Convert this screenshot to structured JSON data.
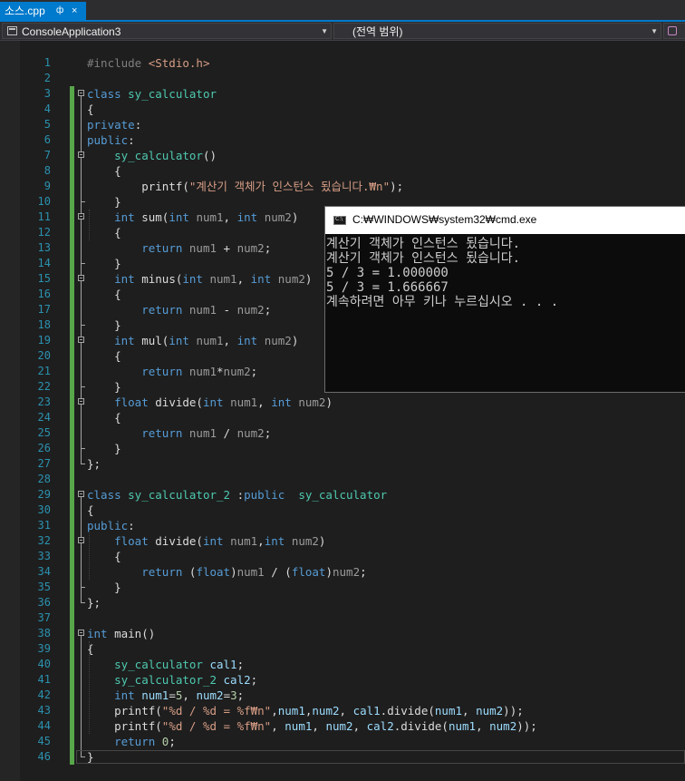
{
  "tab": {
    "title": "소스.cpp",
    "pin": "ф",
    "close": "×"
  },
  "nav": {
    "project": "ConsoleApplication3",
    "scope": "(전역 범위)"
  },
  "lines": [
    [
      [
        "p",
        "#include "
      ],
      [
        "s",
        "<Stdio.h>"
      ]
    ],
    [],
    [
      [
        "k",
        "class "
      ],
      [
        "t",
        "sy_calculator"
      ]
    ],
    [
      [
        "f",
        "{"
      ]
    ],
    [
      [
        "k",
        "private"
      ],
      [
        "f",
        ":"
      ]
    ],
    [
      [
        "k",
        "public"
      ],
      [
        "f",
        ":"
      ]
    ],
    [
      [
        "f",
        "    "
      ],
      [
        "t",
        "sy_calculator"
      ],
      [
        "f",
        "()"
      ]
    ],
    [
      [
        "f",
        "    {"
      ]
    ],
    [
      [
        "f",
        "        printf("
      ],
      [
        "s",
        "\"계산기 객체가 인스턴스 됬습니다.₩n\""
      ],
      [
        "f",
        ");"
      ]
    ],
    [
      [
        "f",
        "    }"
      ]
    ],
    [
      [
        "f",
        "    "
      ],
      [
        "k",
        "int "
      ],
      [
        "f",
        "sum("
      ],
      [
        "k",
        "int "
      ],
      [
        "m",
        "num1"
      ],
      [
        "f",
        ", "
      ],
      [
        "k",
        "int "
      ],
      [
        "m",
        "num2"
      ],
      [
        "f",
        ")"
      ]
    ],
    [
      [
        "f",
        "    {"
      ]
    ],
    [
      [
        "f",
        "        "
      ],
      [
        "k",
        "return "
      ],
      [
        "m",
        "num1"
      ],
      [
        "f",
        " + "
      ],
      [
        "m",
        "num2"
      ],
      [
        "f",
        ";"
      ]
    ],
    [
      [
        "f",
        "    }"
      ]
    ],
    [
      [
        "f",
        "    "
      ],
      [
        "k",
        "int "
      ],
      [
        "f",
        "minus("
      ],
      [
        "k",
        "int "
      ],
      [
        "m",
        "num1"
      ],
      [
        "f",
        ", "
      ],
      [
        "k",
        "int "
      ],
      [
        "m",
        "num2"
      ],
      [
        "f",
        ")"
      ]
    ],
    [
      [
        "f",
        "    {"
      ]
    ],
    [
      [
        "f",
        "        "
      ],
      [
        "k",
        "return "
      ],
      [
        "m",
        "num1"
      ],
      [
        "f",
        " - "
      ],
      [
        "m",
        "num2"
      ],
      [
        "f",
        ";"
      ]
    ],
    [
      [
        "f",
        "    }"
      ]
    ],
    [
      [
        "f",
        "    "
      ],
      [
        "k",
        "int "
      ],
      [
        "f",
        "mul("
      ],
      [
        "k",
        "int "
      ],
      [
        "m",
        "num1"
      ],
      [
        "f",
        ", "
      ],
      [
        "k",
        "int "
      ],
      [
        "m",
        "num2"
      ],
      [
        "f",
        ")"
      ]
    ],
    [
      [
        "f",
        "    {"
      ]
    ],
    [
      [
        "f",
        "        "
      ],
      [
        "k",
        "return "
      ],
      [
        "m",
        "num1"
      ],
      [
        "f",
        "*"
      ],
      [
        "m",
        "num2"
      ],
      [
        "f",
        ";"
      ]
    ],
    [
      [
        "f",
        "    }"
      ]
    ],
    [
      [
        "f",
        "    "
      ],
      [
        "k",
        "float "
      ],
      [
        "f",
        "divide("
      ],
      [
        "k",
        "int "
      ],
      [
        "m",
        "num1"
      ],
      [
        "f",
        ", "
      ],
      [
        "k",
        "int "
      ],
      [
        "m",
        "num2"
      ],
      [
        "f",
        ")"
      ]
    ],
    [
      [
        "f",
        "    {"
      ]
    ],
    [
      [
        "f",
        "        "
      ],
      [
        "k",
        "return "
      ],
      [
        "m",
        "num1"
      ],
      [
        "f",
        " / "
      ],
      [
        "m",
        "num2"
      ],
      [
        "f",
        ";"
      ]
    ],
    [
      [
        "f",
        "    }"
      ]
    ],
    [
      [
        "f",
        "};"
      ]
    ],
    [],
    [
      [
        "k",
        "class "
      ],
      [
        "t",
        "sy_calculator_2 "
      ],
      [
        "f",
        ":"
      ],
      [
        "k",
        "public  "
      ],
      [
        "t",
        "sy_calculator"
      ]
    ],
    [
      [
        "f",
        "{"
      ]
    ],
    [
      [
        "k",
        "public"
      ],
      [
        "f",
        ":"
      ]
    ],
    [
      [
        "f",
        "    "
      ],
      [
        "k",
        "float "
      ],
      [
        "f",
        "divide("
      ],
      [
        "k",
        "int "
      ],
      [
        "m",
        "num1"
      ],
      [
        "f",
        ","
      ],
      [
        "k",
        "int "
      ],
      [
        "m",
        "num2"
      ],
      [
        "f",
        ")"
      ]
    ],
    [
      [
        "f",
        "    {"
      ]
    ],
    [
      [
        "f",
        "        "
      ],
      [
        "k",
        "return "
      ],
      [
        "f",
        "("
      ],
      [
        "k",
        "float"
      ],
      [
        "f",
        ")"
      ],
      [
        "m",
        "num1"
      ],
      [
        "f",
        " / ("
      ],
      [
        "k",
        "float"
      ],
      [
        "f",
        ")"
      ],
      [
        "m",
        "num2"
      ],
      [
        "f",
        ";"
      ]
    ],
    [
      [
        "f",
        "    }"
      ]
    ],
    [
      [
        "f",
        "};"
      ]
    ],
    [],
    [
      [
        "k",
        "int "
      ],
      [
        "f",
        "main()"
      ]
    ],
    [
      [
        "f",
        "{"
      ]
    ],
    [
      [
        "f",
        "    "
      ],
      [
        "t",
        "sy_calculator "
      ],
      [
        "v",
        "cal1"
      ],
      [
        "f",
        ";"
      ]
    ],
    [
      [
        "f",
        "    "
      ],
      [
        "t",
        "sy_calculator_2 "
      ],
      [
        "v",
        "cal2"
      ],
      [
        "f",
        ";"
      ]
    ],
    [
      [
        "f",
        "    "
      ],
      [
        "k",
        "int "
      ],
      [
        "v",
        "num1"
      ],
      [
        "f",
        "="
      ],
      [
        "n",
        "5"
      ],
      [
        "f",
        ", "
      ],
      [
        "v",
        "num2"
      ],
      [
        "f",
        "="
      ],
      [
        "n",
        "3"
      ],
      [
        "f",
        ";"
      ]
    ],
    [
      [
        "f",
        "    printf("
      ],
      [
        "s",
        "\"%d / %d = %f₩n\""
      ],
      [
        "f",
        ","
      ],
      [
        "v",
        "num1"
      ],
      [
        "f",
        ","
      ],
      [
        "v",
        "num2"
      ],
      [
        "f",
        ", "
      ],
      [
        "v",
        "cal1"
      ],
      [
        "f",
        ".divide("
      ],
      [
        "v",
        "num1"
      ],
      [
        "f",
        ", "
      ],
      [
        "v",
        "num2"
      ],
      [
        "f",
        "));"
      ]
    ],
    [
      [
        "f",
        "    printf("
      ],
      [
        "s",
        "\"%d / %d = %f₩n\""
      ],
      [
        "f",
        ", "
      ],
      [
        "v",
        "num1"
      ],
      [
        "f",
        ", "
      ],
      [
        "v",
        "num2"
      ],
      [
        "f",
        ", "
      ],
      [
        "v",
        "cal2"
      ],
      [
        "f",
        ".divide("
      ],
      [
        "v",
        "num1"
      ],
      [
        "f",
        ", "
      ],
      [
        "v",
        "num2"
      ],
      [
        "f",
        "));"
      ]
    ],
    [
      [
        "f",
        "    "
      ],
      [
        "k",
        "return "
      ],
      [
        "n",
        "0"
      ],
      [
        "f",
        ";"
      ]
    ],
    [
      [
        "f",
        "}"
      ]
    ]
  ],
  "cmd": {
    "title": "C:₩WINDOWS₩system32₩cmd.exe",
    "output": [
      "계산기 객체가 인스턴스 됬습니다.",
      "계산기 객체가 인스턴스 됬습니다.",
      "5 / 3 = 1.000000",
      "5 / 3 = 1.666667",
      "계속하려면 아무 키나 누르십시오 . . ."
    ]
  }
}
